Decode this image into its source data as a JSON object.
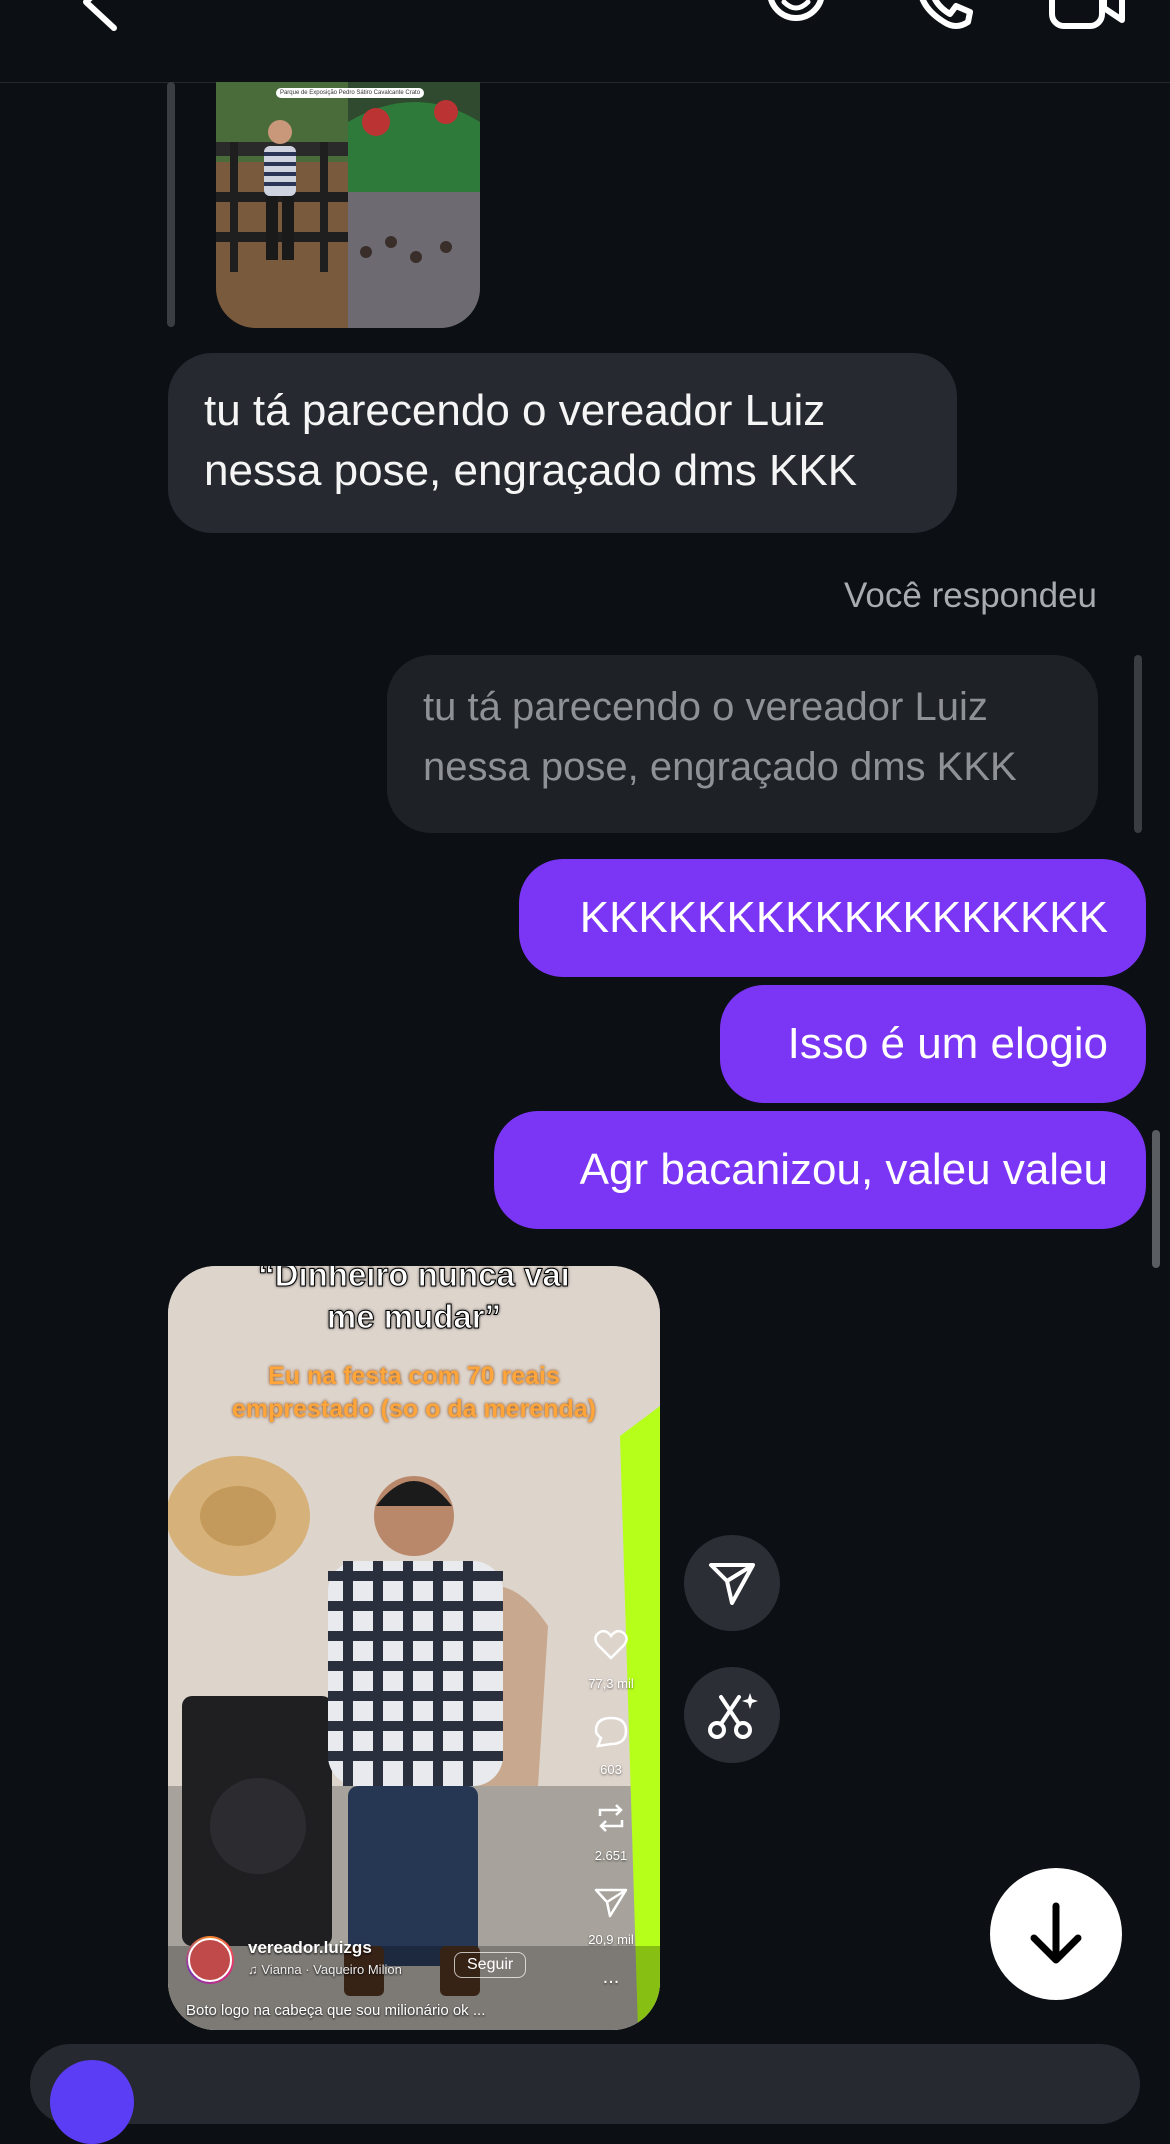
{
  "header": {
    "back_icon": "chevron-left-icon",
    "sticker_icon": "sticker-icon",
    "call_icon": "phone-icon",
    "video_icon": "video-camera-icon"
  },
  "photo_post": {
    "location_caption": "Parque de Exposição Pedro Sátiro Cavalcante Crato"
  },
  "messages": {
    "incoming_1": {
      "line1": "tu tá parecendo o vereador Luiz",
      "line2": "nessa pose, engraçado dms KKK"
    },
    "replied_label": "Você respondeu",
    "quoted": {
      "line1": "tu tá parecendo o vereador Luiz",
      "line2": "nessa pose, engraçado dms KKK"
    },
    "outgoing": [
      "KKKKKKKKKKKKKKKKKK",
      "Isso é um elogio",
      "Agr bacanizou, valeu valeu"
    ]
  },
  "reel": {
    "caption_top_1": "“Dinheiro nunca vai",
    "caption_top_2": "me mudar”",
    "caption_sub_1": "Eu na festa com 70 reais",
    "caption_sub_2": "emprestado (so o da merenda)",
    "likes": "77,3 mil",
    "comments": "603",
    "reposts": "2.651",
    "shares": "20,9 mil",
    "more": "...",
    "username": "vereador.luizgs",
    "audio": "Vianna · Vaqueiro Milion",
    "follow_label": "Seguir",
    "description": "Boto logo na cabeça que sou milionário ok ..."
  },
  "side_actions": {
    "share_icon": "send-icon",
    "remix_icon": "scissors-sparkle-icon"
  },
  "scroll_down_icon": "arrow-down-icon",
  "colors": {
    "background": "#0c1014",
    "incoming_bubble": "#262a30",
    "outgoing_bubble": "#7b35f5"
  }
}
